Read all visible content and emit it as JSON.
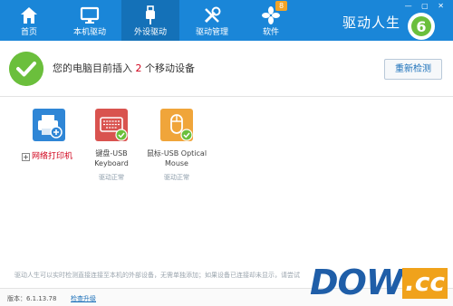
{
  "nav": {
    "items": [
      {
        "label": "首页",
        "icon": "home-icon"
      },
      {
        "label": "本机驱动",
        "icon": "monitor-icon"
      },
      {
        "label": "外设驱动",
        "icon": "usb-icon",
        "active": true
      },
      {
        "label": "驱动管理",
        "icon": "tools-icon"
      },
      {
        "label": "软件",
        "icon": "apps-icon",
        "badge": "8"
      }
    ],
    "brand": "驱动人生",
    "brand_logo_digit": "6"
  },
  "status": {
    "prefix": "您的电脑目前插入",
    "count": "2",
    "suffix": "个移动设备",
    "rescan_label": "重新检测"
  },
  "devices": [
    {
      "name_line1": "键盘-USB",
      "name_line2": "Keyboard",
      "state": "驱动正常"
    },
    {
      "name_line1": "鼠标-USB Optical",
      "name_line2": "Mouse",
      "state": "驱动正常"
    }
  ],
  "printer": {
    "link_label": "网络打印机",
    "plus": "+"
  },
  "hint": "驱动人生可以实时检测直接连接至本机的外部设备，无需单独添加；如果设备已连接却未显示，请尝试",
  "footer": {
    "version": "版本：6.1.13.78",
    "upgrade": "检查升级"
  },
  "watermark": {
    "text": "DOWN",
    "suffix": ".cc"
  },
  "colors": {
    "nav_bg": "#1a86d8",
    "nav_active": "#1471b8",
    "success": "#6bbf3c",
    "accent_red": "#d0021b",
    "link": "#1a6fb9"
  }
}
